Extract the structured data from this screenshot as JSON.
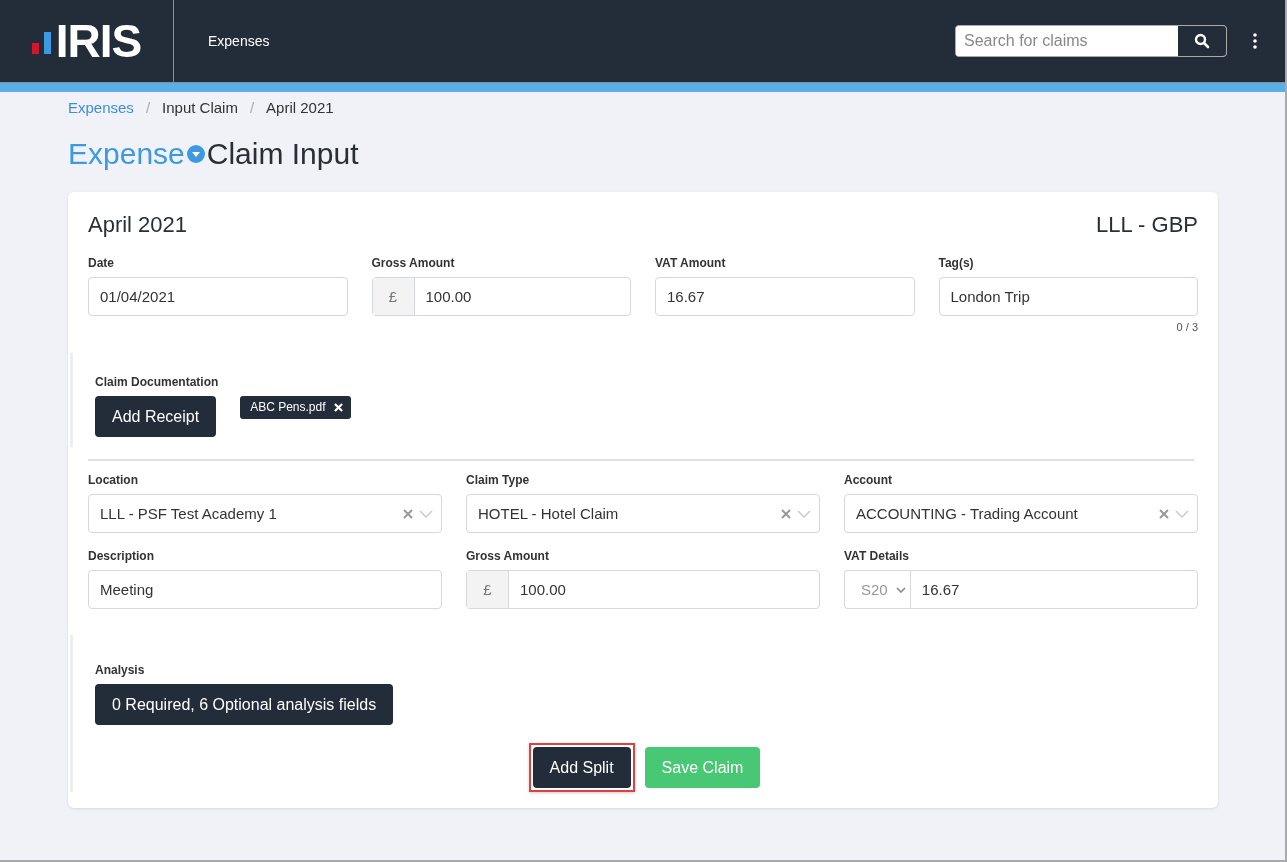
{
  "header": {
    "logo": "IRIS",
    "app_name": "Expenses",
    "search": {
      "placeholder": "Search for claims"
    }
  },
  "breadcrumb": {
    "separator": "/",
    "items": [
      {
        "label": "Expenses",
        "link": true
      },
      {
        "label": "Input Claim",
        "link": false
      },
      {
        "label": "April 2021",
        "link": false
      }
    ]
  },
  "page_title": {
    "prefix": "Expense",
    "title": "Claim Input"
  },
  "claim": {
    "period": "April 2021",
    "currency": "LLL - GBP",
    "fields": [
      {
        "label": "Date",
        "kind": "text",
        "value": "01/04/2021"
      },
      {
        "label": "Gross Amount",
        "kind": "currency",
        "prefix": "£",
        "value": "100.00"
      },
      {
        "label": "VAT Amount",
        "kind": "text",
        "value": "16.67"
      },
      {
        "label": "Tag(s)",
        "kind": "tags",
        "value": "London Trip",
        "counter": "0 / 3"
      }
    ],
    "documentation": {
      "label": "Claim Documentation",
      "button": "Add Receipt",
      "files": [
        {
          "name": "ABC Pens.pdf"
        }
      ]
    },
    "split_fields": [
      {
        "label": "Location",
        "kind": "select",
        "value": "LLL - PSF Test Academy 1"
      },
      {
        "label": "Claim Type",
        "kind": "select",
        "value": "HOTEL - Hotel Claim"
      },
      {
        "label": "Account",
        "kind": "select",
        "value": "ACCOUNTING - Trading Account"
      },
      {
        "label": "Description",
        "kind": "text",
        "value": "Meeting"
      },
      {
        "label": "Gross Amount",
        "kind": "currency",
        "prefix": "£",
        "value": "100.00"
      },
      {
        "label": "VAT Details",
        "kind": "vat",
        "code": "S20",
        "value": "16.67"
      }
    ],
    "analysis": {
      "label": "Analysis",
      "button": "0 Required, 6 Optional analysis fields"
    },
    "actions": [
      {
        "label": "Add Split",
        "kind": "dark",
        "highlighted": true
      },
      {
        "label": "Save Claim",
        "kind": "success",
        "highlighted": false
      }
    ]
  }
}
